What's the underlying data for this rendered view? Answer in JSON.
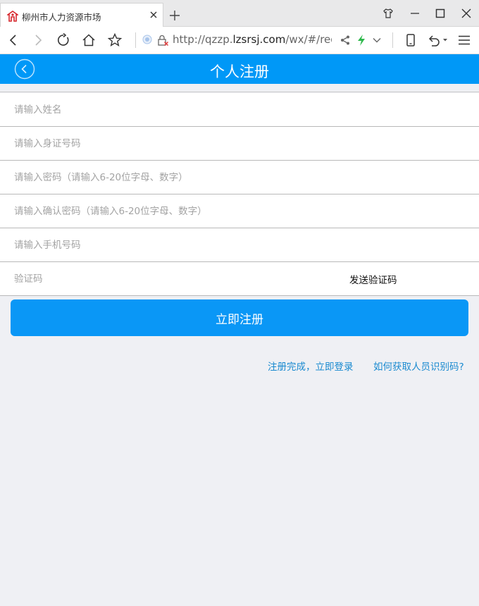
{
  "browser": {
    "tab_title": "柳州市人力资源市场",
    "url_prefix": "http://qzzp.",
    "url_domain": "lzsrsj.com",
    "url_suffix": "/wx/#/regist"
  },
  "app": {
    "title": "个人注册"
  },
  "form": {
    "name_placeholder": "请输入姓名",
    "id_placeholder": "请输入身证号码",
    "password_placeholder": "请输入密码（请输入6-20位字母、数字）",
    "confirm_placeholder": "请输入确认密码（请输入6-20位字母、数字）",
    "phone_placeholder": "请输入手机号码",
    "code_placeholder": "验证码",
    "send_code_label": "发送验证码",
    "submit_label": "立即注册"
  },
  "links": {
    "login": "注册完成，立即登录",
    "help": "如何获取人员识别码?"
  },
  "colors": {
    "accent": "#0098f7",
    "link": "#1a8ad0",
    "background": "#eff0f4"
  }
}
